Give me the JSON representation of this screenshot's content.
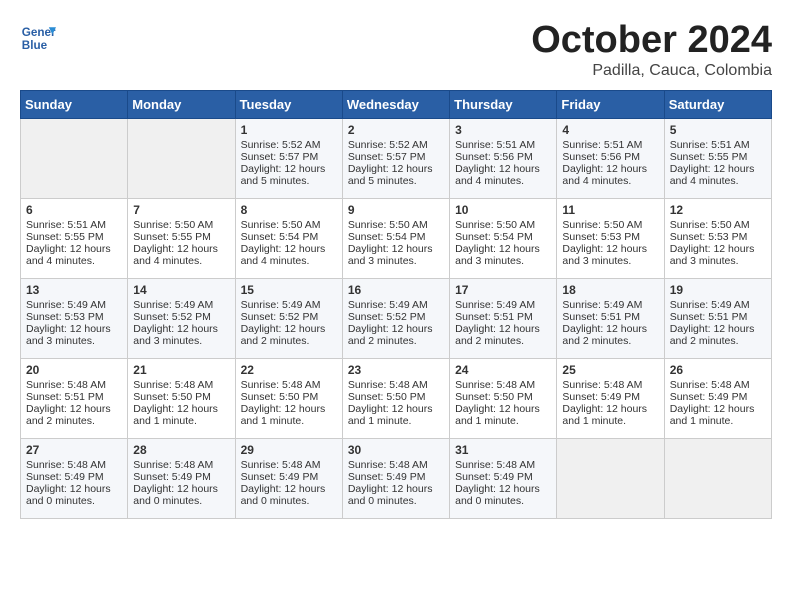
{
  "header": {
    "logo_line1": "General",
    "logo_line2": "Blue",
    "month": "October 2024",
    "location": "Padilla, Cauca, Colombia"
  },
  "weekdays": [
    "Sunday",
    "Monday",
    "Tuesday",
    "Wednesday",
    "Thursday",
    "Friday",
    "Saturday"
  ],
  "weeks": [
    [
      {
        "day": "",
        "empty": true
      },
      {
        "day": "",
        "empty": true
      },
      {
        "day": "1",
        "sunrise": "Sunrise: 5:52 AM",
        "sunset": "Sunset: 5:57 PM",
        "daylight": "Daylight: 12 hours and 5 minutes."
      },
      {
        "day": "2",
        "sunrise": "Sunrise: 5:52 AM",
        "sunset": "Sunset: 5:57 PM",
        "daylight": "Daylight: 12 hours and 5 minutes."
      },
      {
        "day": "3",
        "sunrise": "Sunrise: 5:51 AM",
        "sunset": "Sunset: 5:56 PM",
        "daylight": "Daylight: 12 hours and 4 minutes."
      },
      {
        "day": "4",
        "sunrise": "Sunrise: 5:51 AM",
        "sunset": "Sunset: 5:56 PM",
        "daylight": "Daylight: 12 hours and 4 minutes."
      },
      {
        "day": "5",
        "sunrise": "Sunrise: 5:51 AM",
        "sunset": "Sunset: 5:55 PM",
        "daylight": "Daylight: 12 hours and 4 minutes."
      }
    ],
    [
      {
        "day": "6",
        "sunrise": "Sunrise: 5:51 AM",
        "sunset": "Sunset: 5:55 PM",
        "daylight": "Daylight: 12 hours and 4 minutes."
      },
      {
        "day": "7",
        "sunrise": "Sunrise: 5:50 AM",
        "sunset": "Sunset: 5:55 PM",
        "daylight": "Daylight: 12 hours and 4 minutes."
      },
      {
        "day": "8",
        "sunrise": "Sunrise: 5:50 AM",
        "sunset": "Sunset: 5:54 PM",
        "daylight": "Daylight: 12 hours and 4 minutes."
      },
      {
        "day": "9",
        "sunrise": "Sunrise: 5:50 AM",
        "sunset": "Sunset: 5:54 PM",
        "daylight": "Daylight: 12 hours and 3 minutes."
      },
      {
        "day": "10",
        "sunrise": "Sunrise: 5:50 AM",
        "sunset": "Sunset: 5:54 PM",
        "daylight": "Daylight: 12 hours and 3 minutes."
      },
      {
        "day": "11",
        "sunrise": "Sunrise: 5:50 AM",
        "sunset": "Sunset: 5:53 PM",
        "daylight": "Daylight: 12 hours and 3 minutes."
      },
      {
        "day": "12",
        "sunrise": "Sunrise: 5:50 AM",
        "sunset": "Sunset: 5:53 PM",
        "daylight": "Daylight: 12 hours and 3 minutes."
      }
    ],
    [
      {
        "day": "13",
        "sunrise": "Sunrise: 5:49 AM",
        "sunset": "Sunset: 5:53 PM",
        "daylight": "Daylight: 12 hours and 3 minutes."
      },
      {
        "day": "14",
        "sunrise": "Sunrise: 5:49 AM",
        "sunset": "Sunset: 5:52 PM",
        "daylight": "Daylight: 12 hours and 3 minutes."
      },
      {
        "day": "15",
        "sunrise": "Sunrise: 5:49 AM",
        "sunset": "Sunset: 5:52 PM",
        "daylight": "Daylight: 12 hours and 2 minutes."
      },
      {
        "day": "16",
        "sunrise": "Sunrise: 5:49 AM",
        "sunset": "Sunset: 5:52 PM",
        "daylight": "Daylight: 12 hours and 2 minutes."
      },
      {
        "day": "17",
        "sunrise": "Sunrise: 5:49 AM",
        "sunset": "Sunset: 5:51 PM",
        "daylight": "Daylight: 12 hours and 2 minutes."
      },
      {
        "day": "18",
        "sunrise": "Sunrise: 5:49 AM",
        "sunset": "Sunset: 5:51 PM",
        "daylight": "Daylight: 12 hours and 2 minutes."
      },
      {
        "day": "19",
        "sunrise": "Sunrise: 5:49 AM",
        "sunset": "Sunset: 5:51 PM",
        "daylight": "Daylight: 12 hours and 2 minutes."
      }
    ],
    [
      {
        "day": "20",
        "sunrise": "Sunrise: 5:48 AM",
        "sunset": "Sunset: 5:51 PM",
        "daylight": "Daylight: 12 hours and 2 minutes."
      },
      {
        "day": "21",
        "sunrise": "Sunrise: 5:48 AM",
        "sunset": "Sunset: 5:50 PM",
        "daylight": "Daylight: 12 hours and 1 minute."
      },
      {
        "day": "22",
        "sunrise": "Sunrise: 5:48 AM",
        "sunset": "Sunset: 5:50 PM",
        "daylight": "Daylight: 12 hours and 1 minute."
      },
      {
        "day": "23",
        "sunrise": "Sunrise: 5:48 AM",
        "sunset": "Sunset: 5:50 PM",
        "daylight": "Daylight: 12 hours and 1 minute."
      },
      {
        "day": "24",
        "sunrise": "Sunrise: 5:48 AM",
        "sunset": "Sunset: 5:50 PM",
        "daylight": "Daylight: 12 hours and 1 minute."
      },
      {
        "day": "25",
        "sunrise": "Sunrise: 5:48 AM",
        "sunset": "Sunset: 5:49 PM",
        "daylight": "Daylight: 12 hours and 1 minute."
      },
      {
        "day": "26",
        "sunrise": "Sunrise: 5:48 AM",
        "sunset": "Sunset: 5:49 PM",
        "daylight": "Daylight: 12 hours and 1 minute."
      }
    ],
    [
      {
        "day": "27",
        "sunrise": "Sunrise: 5:48 AM",
        "sunset": "Sunset: 5:49 PM",
        "daylight": "Daylight: 12 hours and 0 minutes."
      },
      {
        "day": "28",
        "sunrise": "Sunrise: 5:48 AM",
        "sunset": "Sunset: 5:49 PM",
        "daylight": "Daylight: 12 hours and 0 minutes."
      },
      {
        "day": "29",
        "sunrise": "Sunrise: 5:48 AM",
        "sunset": "Sunset: 5:49 PM",
        "daylight": "Daylight: 12 hours and 0 minutes."
      },
      {
        "day": "30",
        "sunrise": "Sunrise: 5:48 AM",
        "sunset": "Sunset: 5:49 PM",
        "daylight": "Daylight: 12 hours and 0 minutes."
      },
      {
        "day": "31",
        "sunrise": "Sunrise: 5:48 AM",
        "sunset": "Sunset: 5:49 PM",
        "daylight": "Daylight: 12 hours and 0 minutes."
      },
      {
        "day": "",
        "empty": true
      },
      {
        "day": "",
        "empty": true
      }
    ]
  ]
}
